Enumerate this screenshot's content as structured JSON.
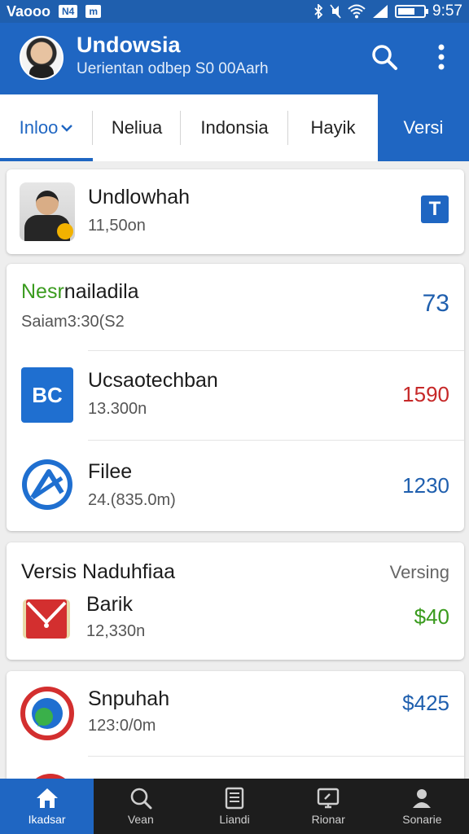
{
  "status_bar": {
    "app_label": "Vaooo",
    "chip_label": "N4",
    "carrier_mark": "m",
    "time": "9:57",
    "battery_level": 0.7,
    "icons": [
      "bluetooth-icon",
      "mute-icon",
      "wifi-icon",
      "signal-icon",
      "battery-icon"
    ]
  },
  "header": {
    "title": "Undowsia",
    "subtitle": "Uerientan odbep S0 00Aarh",
    "icons": [
      "avatar",
      "search-icon",
      "more-vert-icon"
    ]
  },
  "tabs": [
    {
      "label": "Inloo",
      "active": true,
      "has_dropdown": true
    },
    {
      "label": "Neliua",
      "active": false
    },
    {
      "label": "Indonsia",
      "active": false
    },
    {
      "label": "Hayik",
      "active": false
    }
  ],
  "tab_extra": {
    "label": "Versi"
  },
  "cards": {
    "profile": {
      "title": "Undlowhah",
      "subtitle": "11,50on",
      "action_letter": "T"
    },
    "group1": {
      "header_title_green": "Nesr",
      "header_title_rest": "nailadila",
      "header_subtitle": "Saiam3:30(S2",
      "header_value": "73",
      "rows": [
        {
          "icon_text": "BC",
          "title": "Ucsaotechban",
          "subtitle": "13.300n",
          "amount": "1590",
          "amount_color": "#c62828"
        },
        {
          "title": "Filee",
          "subtitle": "24.(835.0m)",
          "amount": "1230",
          "amount_color": "#1f5fae"
        }
      ]
    },
    "group2": {
      "header_left": "Versis",
      "header_title": "Naduhfiaa",
      "header_right": "Versing",
      "rows": [
        {
          "title": "Barik",
          "subtitle": "12,330n",
          "amount": "$40",
          "amount_color": "#3a9b1e"
        }
      ]
    },
    "group3": {
      "rows": [
        {
          "title": "Snpuhah",
          "subtitle": "123:0/0m",
          "amount": "$425",
          "amount_color": "#1f5fae"
        }
      ]
    }
  },
  "bottom_nav": [
    {
      "label": "Ikadsar",
      "icon": "home-icon",
      "active": true
    },
    {
      "label": "Vean",
      "icon": "search-icon",
      "active": false
    },
    {
      "label": "Liandi",
      "icon": "document-icon",
      "active": false
    },
    {
      "label": "Rionar",
      "icon": "screen-icon",
      "active": false
    },
    {
      "label": "Sonarie",
      "icon": "account-icon",
      "active": false
    }
  ],
  "colors": {
    "primary": "#1f66c2",
    "status_bar": "#1f5fae",
    "green": "#3a9b1e",
    "red": "#c62828",
    "nav_dark": "#1d1d1d"
  }
}
